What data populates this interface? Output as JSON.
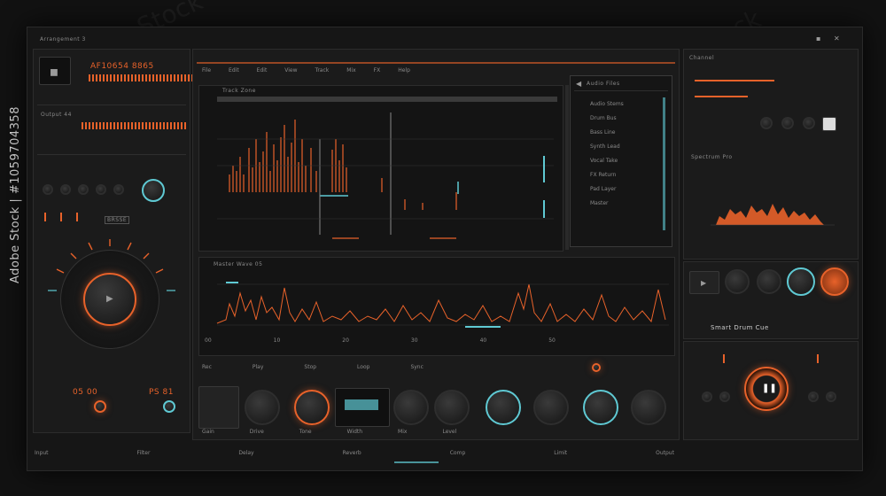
{
  "window": {
    "title": "Arrangement 3"
  },
  "watermark": {
    "side_text": "Adobe Stock | #1059704358",
    "repeat_text": "Adobe Stock"
  },
  "colors": {
    "accent": "#e8622a",
    "secondary": "#5fc9d3",
    "background": "#121212"
  },
  "left_panel": {
    "display_label": "AF10654 8865",
    "section_label": "Output 44",
    "mode_label": "BRSSE",
    "readout_left": "05 00",
    "readout_right": "PS 81",
    "controls_icons": [
      "power-icon",
      "settings-icon",
      "link-icon"
    ]
  },
  "main": {
    "toolbar_tabs": [
      "File",
      "Edit",
      "Edit",
      "View",
      "Track",
      "Mix",
      "FX",
      "Help"
    ],
    "track_header": "Track Zone",
    "lower_track_header": "Master Wave 05",
    "transport_labels": [
      "Rec",
      "Play",
      "Stop",
      "Loop",
      "Sync"
    ],
    "timeline_markers": [
      "00",
      "10",
      "20",
      "30",
      "40",
      "50"
    ]
  },
  "browser": {
    "title": "Audio Files",
    "items": [
      "Audio Stems",
      "Drum Bus",
      "Bass Line",
      "Synth Lead",
      "Vocal Take",
      "FX Return",
      "Pad Layer",
      "Master"
    ]
  },
  "right_panel": {
    "top_label": "Channel",
    "eq_label": "Spectrum Pro",
    "mode_label": "Smart Drum Cue",
    "buttons": [
      "play-icon",
      "stop-icon",
      "record-icon",
      "loop-icon"
    ]
  },
  "bottom_bar": {
    "labels": [
      "Input",
      "Filter",
      "Delay",
      "Reverb",
      "Comp",
      "Limit",
      "Output"
    ],
    "knob_labels": [
      "Gain",
      "Drive",
      "Tone",
      "Width",
      "Mix",
      "Level"
    ]
  }
}
